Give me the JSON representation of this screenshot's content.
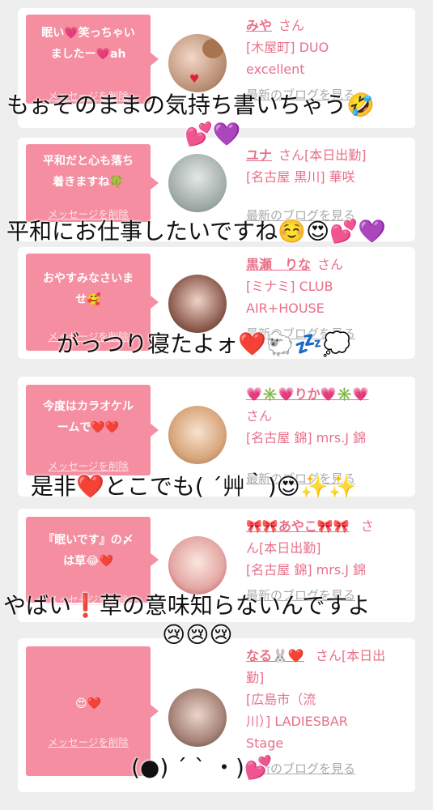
{
  "entries": [
    {
      "message_lines": [
        "眠い💗笑っちゃい",
        "ましたー💗ah"
      ],
      "delete_label": "メッセージを削除",
      "name": "みや",
      "san": "さん",
      "info_lines": [
        "[木屋町] DUO",
        "excellent"
      ],
      "blog_label": "最新のブログを見る",
      "overlay_lines": [
        "もぉそのままの気持ち書いちゃう🤣",
        "💕💜"
      ]
    },
    {
      "message_lines": [
        "平和だと心も落ち",
        "着きますね🍀"
      ],
      "delete_label": "メッセージを削除",
      "name": "ユナ",
      "san": "さん[本日出勤]",
      "info_lines": [
        "[名古屋 黒川] 華咲"
      ],
      "blog_label": "最新のブログを見る",
      "overlay_lines": [
        "平和にお仕事したいですね☺️😍💕💜"
      ]
    },
    {
      "message_lines": [
        "おやすみなさいま",
        "せ🥰"
      ],
      "delete_label": "メッセージを削除",
      "name": "黒瀬　りな",
      "san": "さん",
      "info_lines": [
        "[ミナミ] CLUB",
        "AIR+HOUSE"
      ],
      "blog_label": "最新のブログを見る",
      "overlay_lines": [
        "がっつり寝たよォ❤️🐑💤💭"
      ]
    },
    {
      "message_lines": [
        "今度はカラオケル",
        "ームで❤️❤️"
      ],
      "delete_label": "メッセージを削除",
      "name": "💗✳️💗りか💗✳️💗",
      "san": "さん",
      "info_lines": [
        "[名古屋 錦] mrs.J 錦"
      ],
      "blog_label": "最新のブログを見る",
      "overlay_lines": [
        "是非❤️とこでも( ´艸｀)😍✨✨"
      ]
    },
    {
      "message_lines": [
        "『眠いです』の〆",
        "は草😂❤️"
      ],
      "delete_label": "メッセージを削除",
      "name": "🎀🎀あやこ🎀🎀",
      "san": "さ",
      "info_lines": [
        "ん[本日出勤]",
        "[名古屋 錦] mrs.J 錦"
      ],
      "blog_label": "最新のブログを見る",
      "overlay_lines": [
        "やばい❗️草の意味知らないんですよ",
        "😢😢😢"
      ]
    },
    {
      "message_lines": [
        "😍❤️"
      ],
      "delete_label": "メッセージを削除",
      "name": "なる🐰❤️",
      "san": "さん[本日出",
      "info_lines": [
        "勤]",
        "[広島市（流",
        "川）] LADIESBAR",
        "Stage"
      ],
      "blog_label": "最新のブログを見る",
      "overlay_lines": [
        "(●) ´ ` ・)💕"
      ]
    }
  ]
}
